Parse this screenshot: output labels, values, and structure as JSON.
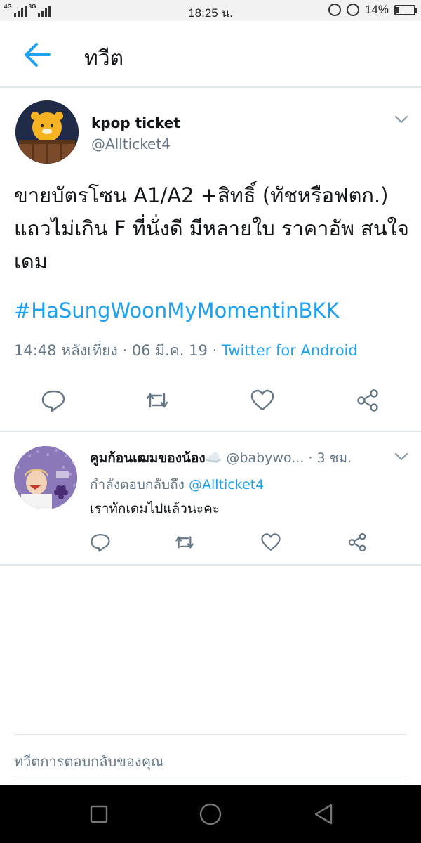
{
  "status_bar": {
    "network_left": "4G",
    "network_right": "3G",
    "time": "18:25 น.",
    "battery": "14%"
  },
  "header": {
    "title": "ทวีต"
  },
  "tweet": {
    "author_name": "kpop ticket",
    "author_handle": "@Allticket4",
    "text": "ขายบัตรโซน A1/A2 +สิทธิ์ (ทัชหรือฟตก.) แถวไม่เกิน F ที่นั่งดี มีหลายใบ ราคาอัพ สนใจเดม",
    "hashtag": "#HaSungWoonMyMomentinBKK",
    "time": "14:48 หลังเที่ยง",
    "date": "06 มี.ค. 19",
    "separator": "·",
    "source": "Twitter for Android",
    "actions": [
      "reply-icon",
      "retweet-icon",
      "like-icon",
      "share-icon"
    ]
  },
  "reply": {
    "author_name": "คูมก้อนเฒมของน้อง",
    "author_emoji": "☁️",
    "author_handle": "@babywo...",
    "separator": "·",
    "time": "3 ชม.",
    "replying_to_label": "กำลังตอบกลับถึง",
    "replying_to_mention": "@Allticket4",
    "text": "เราทักเดมไปแล้วนะคะ"
  },
  "compose": {
    "placeholder": "ทวีตการตอบกลับของคุณ"
  },
  "colors": {
    "accent": "#1da1f2",
    "secondary_text": "#657786",
    "divider": "#e1e8ed",
    "nav_bar": "#000000"
  }
}
